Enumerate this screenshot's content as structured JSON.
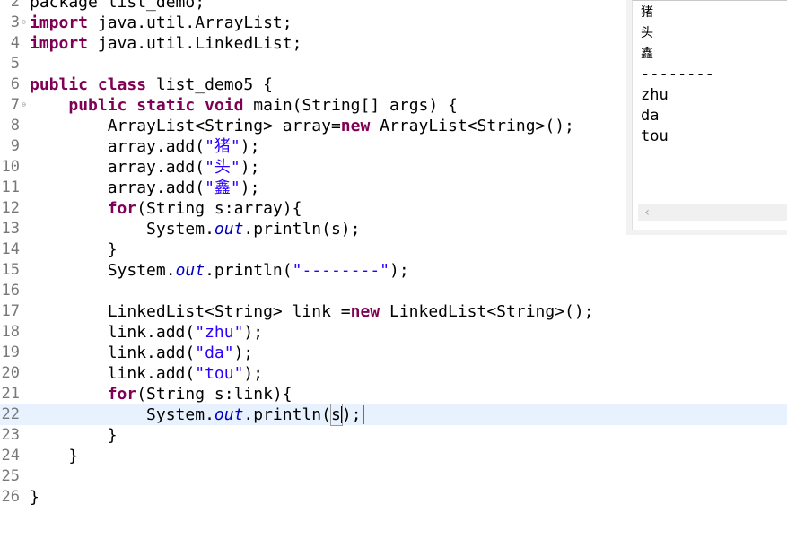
{
  "editor": {
    "lines": [
      {
        "num": "2",
        "fold": "",
        "segments": [
          {
            "t": "package list_demo;",
            "c": "plain"
          }
        ]
      },
      {
        "num": "3",
        "fold": "⊖",
        "segments": [
          {
            "t": "import",
            "c": "kw"
          },
          {
            "t": " java.util.ArrayList;",
            "c": "plain"
          }
        ]
      },
      {
        "num": "4",
        "fold": "",
        "segments": [
          {
            "t": "import",
            "c": "kw"
          },
          {
            "t": " java.util.LinkedList;",
            "c": "plain"
          }
        ]
      },
      {
        "num": "5",
        "fold": "",
        "segments": []
      },
      {
        "num": "6",
        "fold": "",
        "segments": [
          {
            "t": "public",
            "c": "kw"
          },
          {
            "t": " ",
            "c": "plain"
          },
          {
            "t": "class",
            "c": "kw"
          },
          {
            "t": " list_demo5 {",
            "c": "plain"
          }
        ]
      },
      {
        "num": "7",
        "fold": "⊖",
        "segments": [
          {
            "t": "    ",
            "c": "plain"
          },
          {
            "t": "public",
            "c": "kw"
          },
          {
            "t": " ",
            "c": "plain"
          },
          {
            "t": "static",
            "c": "kw"
          },
          {
            "t": " ",
            "c": "plain"
          },
          {
            "t": "void",
            "c": "kw"
          },
          {
            "t": " main(String[] args) {",
            "c": "plain"
          }
        ]
      },
      {
        "num": "8",
        "fold": "",
        "segments": [
          {
            "t": "        ArrayList<String> array=",
            "c": "plain"
          },
          {
            "t": "new",
            "c": "kw"
          },
          {
            "t": " ArrayList<String>();",
            "c": "plain"
          }
        ]
      },
      {
        "num": "9",
        "fold": "",
        "segments": [
          {
            "t": "        array.add(",
            "c": "plain"
          },
          {
            "t": "\"猪\"",
            "c": "str"
          },
          {
            "t": ");",
            "c": "plain"
          }
        ]
      },
      {
        "num": "10",
        "fold": "",
        "segments": [
          {
            "t": "        array.add(",
            "c": "plain"
          },
          {
            "t": "\"头\"",
            "c": "str"
          },
          {
            "t": ");",
            "c": "plain"
          }
        ]
      },
      {
        "num": "11",
        "fold": "",
        "segments": [
          {
            "t": "        array.add(",
            "c": "plain"
          },
          {
            "t": "\"鑫\"",
            "c": "str"
          },
          {
            "t": ");",
            "c": "plain"
          }
        ]
      },
      {
        "num": "12",
        "fold": "",
        "segments": [
          {
            "t": "        ",
            "c": "plain"
          },
          {
            "t": "for",
            "c": "kw"
          },
          {
            "t": "(String s:array){",
            "c": "plain"
          }
        ]
      },
      {
        "num": "13",
        "fold": "",
        "segments": [
          {
            "t": "            System.",
            "c": "plain"
          },
          {
            "t": "out",
            "c": "fld"
          },
          {
            "t": ".println(s);",
            "c": "plain"
          }
        ]
      },
      {
        "num": "14",
        "fold": "",
        "segments": [
          {
            "t": "        }",
            "c": "plain"
          }
        ]
      },
      {
        "num": "15",
        "fold": "",
        "segments": [
          {
            "t": "        System.",
            "c": "plain"
          },
          {
            "t": "out",
            "c": "fld"
          },
          {
            "t": ".println(",
            "c": "plain"
          },
          {
            "t": "\"--------\"",
            "c": "str"
          },
          {
            "t": ");",
            "c": "plain"
          }
        ]
      },
      {
        "num": "16",
        "fold": "",
        "segments": []
      },
      {
        "num": "17",
        "fold": "",
        "segments": [
          {
            "t": "        LinkedList<String> link =",
            "c": "plain"
          },
          {
            "t": "new",
            "c": "kw"
          },
          {
            "t": " LinkedList<String>();",
            "c": "plain"
          }
        ]
      },
      {
        "num": "18",
        "fold": "",
        "segments": [
          {
            "t": "        link.add(",
            "c": "plain"
          },
          {
            "t": "\"zhu\"",
            "c": "str"
          },
          {
            "t": ");",
            "c": "plain"
          }
        ]
      },
      {
        "num": "19",
        "fold": "",
        "segments": [
          {
            "t": "        link.add(",
            "c": "plain"
          },
          {
            "t": "\"da\"",
            "c": "str"
          },
          {
            "t": ");",
            "c": "plain"
          }
        ]
      },
      {
        "num": "20",
        "fold": "",
        "segments": [
          {
            "t": "        link.add(",
            "c": "plain"
          },
          {
            "t": "\"tou\"",
            "c": "str"
          },
          {
            "t": ");",
            "c": "plain"
          }
        ]
      },
      {
        "num": "21",
        "fold": "",
        "segments": [
          {
            "t": "        ",
            "c": "plain"
          },
          {
            "t": "for",
            "c": "kw"
          },
          {
            "t": "(String s:link){",
            "c": "plain"
          }
        ]
      },
      {
        "num": "22",
        "fold": "",
        "current": true,
        "segments": [
          {
            "t": "            System.",
            "c": "plain"
          },
          {
            "t": "out",
            "c": "fld"
          },
          {
            "t": ".println(",
            "c": "plain"
          },
          {
            "t": "s",
            "c": "caret-box"
          },
          {
            "t": ");",
            "c": "plain"
          }
        ]
      },
      {
        "num": "23",
        "fold": "",
        "segments": [
          {
            "t": "        }",
            "c": "plain"
          }
        ]
      },
      {
        "num": "24",
        "fold": "",
        "segments": [
          {
            "t": "    }",
            "c": "plain"
          }
        ]
      },
      {
        "num": "25",
        "fold": "",
        "segments": []
      },
      {
        "num": "26",
        "fold": "",
        "segments": [
          {
            "t": "}",
            "c": "plain"
          }
        ]
      }
    ]
  },
  "console": {
    "lines": [
      "猪",
      "头",
      "鑫",
      "--------",
      "zhu",
      "da",
      "tou"
    ],
    "scroll_left_glyph": "‹"
  }
}
